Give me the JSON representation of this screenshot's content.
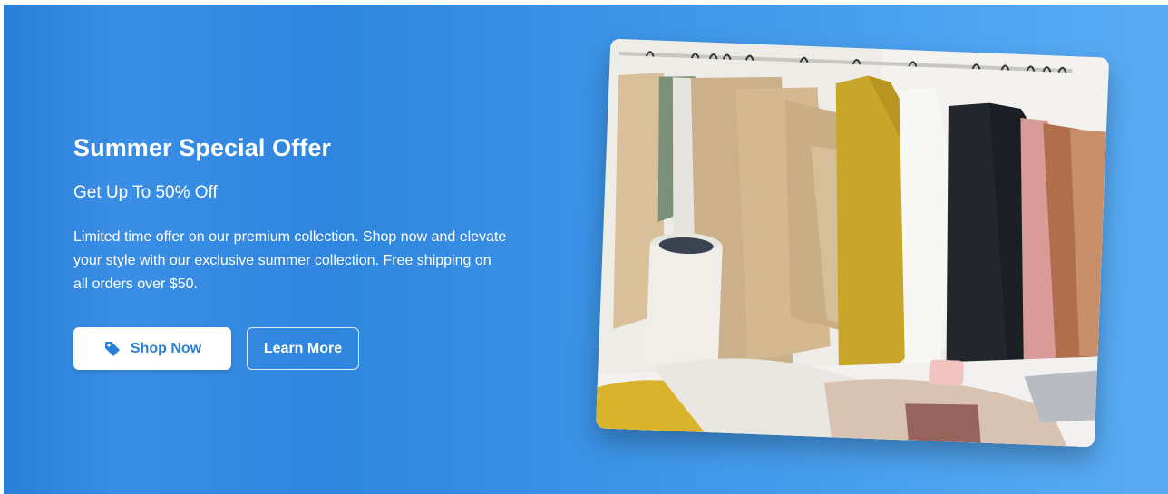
{
  "hero": {
    "title": "Summer Special Offer",
    "subtitle": "Get Up To 50% Off",
    "description": "Limited time offer on our premium collection. Shop now and elevate your style with our exclusive summer collection. Free shipping on all orders over $50.",
    "primary_button": {
      "label": "Shop Now",
      "icon": "tag-icon"
    },
    "secondary_button": {
      "label": "Learn More"
    },
    "image": {
      "subject": "clothing-rack-photo"
    }
  },
  "colors": {
    "background_start": "#2a7fd8",
    "background_end": "#5aabf3",
    "button_text": "#2a7fd8",
    "text": "#ffffff"
  }
}
